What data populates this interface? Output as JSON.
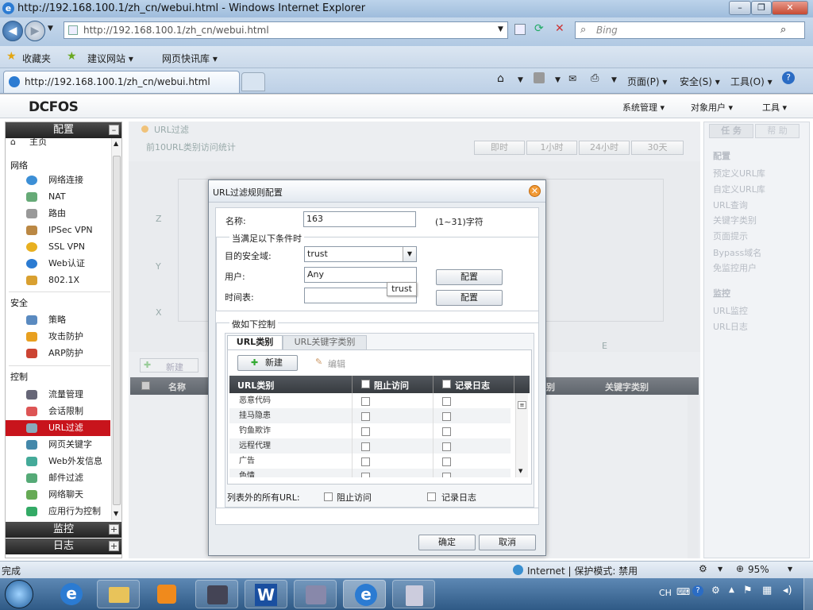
{
  "window": {
    "title": "http://192.168.100.1/zh_cn/webui.html - Windows Internet Explorer"
  },
  "browser": {
    "url": "http://192.168.100.1/zh_cn/webui.html",
    "search_placeholder": "Bing",
    "favorites": "收藏夹",
    "suggested_sites": "建议网站 ▾",
    "web_slice": "网页快讯库 ▾",
    "tab_title": "http://192.168.100.1/zh_cn/webui.html",
    "cmd_page": "页面(P) ▾",
    "cmd_safety": "安全(S) ▾",
    "cmd_tools": "工具(O) ▾"
  },
  "app": {
    "logo": "DCFOS",
    "menu": [
      "系统管理 ▾",
      "对象用户 ▾",
      "工具 ▾"
    ]
  },
  "sidebar": {
    "header": "配置",
    "top_item": "主页",
    "groups": [
      {
        "title": "网络",
        "items": [
          "网络连接",
          "NAT",
          "路由",
          "IPSec VPN",
          "SSL VPN",
          "Web认证",
          "802.1X"
        ]
      },
      {
        "title": "安全",
        "items": [
          "策略",
          "攻击防护",
          "ARP防护"
        ]
      },
      {
        "title": "控制",
        "items": [
          "流量管理",
          "会话限制",
          "URL过滤",
          "网页关键字",
          "Web外发信息",
          "邮件过滤",
          "网络聊天",
          "应用行为控制"
        ]
      }
    ],
    "monitor": "监控",
    "log": "日志"
  },
  "main": {
    "title": "URL过滤",
    "chart_caption": "前10URL类别访问统计",
    "time_buttons": [
      "即时",
      "1小时",
      "24小时",
      "30天"
    ],
    "axis_labels": [
      "Z",
      "Y",
      "X",
      "E"
    ],
    "new_label": "新建",
    "table_headers": [
      "名称",
      "别",
      "关键字类别"
    ]
  },
  "right_panel": {
    "tabs": [
      "任 务",
      "帮 助"
    ],
    "config_title": "配置",
    "config_items": [
      "预定义URL库",
      "自定义URL库",
      "URL查询",
      "关键字类别",
      "页面提示",
      "Bypass域名",
      "免监控用户"
    ],
    "monitor_title": "监控",
    "monitor_items": [
      "URL监控",
      "URL日志"
    ]
  },
  "dialog": {
    "title": "URL过滤规则配置",
    "name_label": "名称:",
    "name_value": "163",
    "name_hint": "(1~31)字符",
    "cond_legend": "当满足以下条件时",
    "zone_label": "目的安全域:",
    "zone_value": "trust",
    "tooltip": "trust",
    "user_label": "用户:",
    "user_value": "Any",
    "schedule_label": "时间表:",
    "config_btn": "配置",
    "action_legend": "做如下控制",
    "tabs": [
      "URL类别",
      "URL关键字类别"
    ],
    "new_btn": "新建",
    "edit_btn": "编辑",
    "cols": [
      "URL类别",
      "阻止访问",
      "记录日志"
    ],
    "rows": [
      "恶意代码",
      "挂马隐患",
      "钓鱼欺诈",
      "远程代理",
      "广告",
      "色情"
    ],
    "other_label": "列表外的所有URL:",
    "other_block": "阻止访问",
    "other_log": "记录日志",
    "ok": "确定",
    "cancel": "取消"
  },
  "status": {
    "left": "完成",
    "zone": "Internet | 保护模式: 禁用",
    "zoom": "95%"
  },
  "tray": {
    "lang": "CH"
  }
}
